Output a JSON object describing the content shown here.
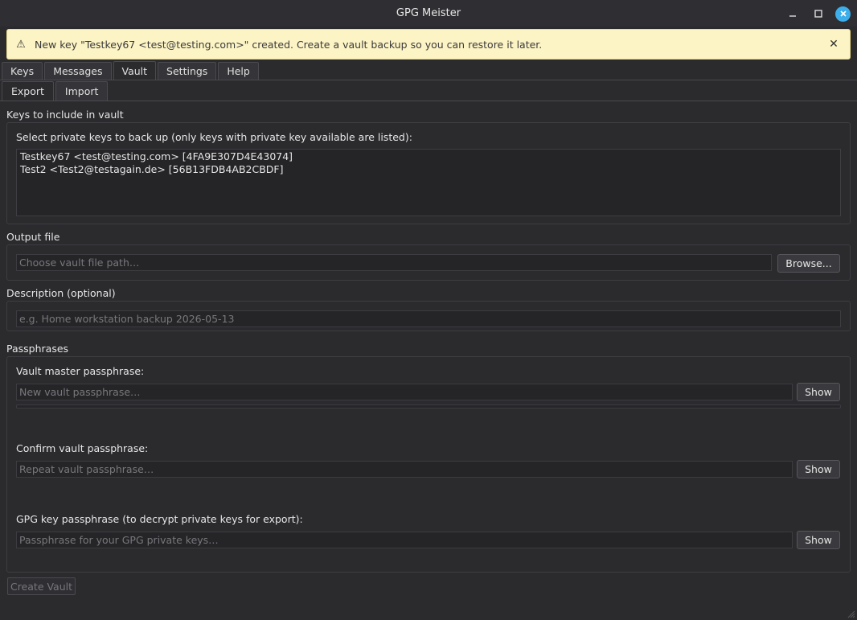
{
  "window": {
    "title": "GPG Meister"
  },
  "banner": {
    "message": "New key \"Testkey67 <test@testing.com>\" created. Create a vault backup so you can restore it later.",
    "close": "✕"
  },
  "tabs": [
    {
      "label": "Keys"
    },
    {
      "label": "Messages"
    },
    {
      "label": "Vault",
      "active": true
    },
    {
      "label": "Settings"
    },
    {
      "label": "Help"
    }
  ],
  "subtabs": [
    {
      "label": "Export",
      "active": true
    },
    {
      "label": "Import"
    }
  ],
  "keys_section": {
    "title": "Keys to include in vault",
    "instruction": "Select private keys to back up (only keys with private key available are listed):",
    "keys": [
      "Testkey67 <test@testing.com>  [4FA9E307D4E43074]",
      "Test2 <Test2@testagain.de>  [56B13FDB4AB2CBDF]"
    ]
  },
  "output_section": {
    "title": "Output file",
    "placeholder": "Choose vault file path…",
    "browse_label": "Browse..."
  },
  "description_section": {
    "title": "Description (optional)",
    "placeholder": "e.g. Home workstation backup 2026-05-13"
  },
  "passphrase_section": {
    "title": "Passphrases",
    "master_label": "Vault master passphrase:",
    "master_placeholder": "New vault passphrase…",
    "confirm_label": "Confirm vault passphrase:",
    "confirm_placeholder": "Repeat vault passphrase…",
    "gpg_label": "GPG key passphrase (to decrypt private keys for export):",
    "gpg_placeholder": "Passphrase for your GPG private keys…",
    "show_label": "Show",
    "strength_value": 0
  },
  "create_button": {
    "label": "Create Vault",
    "enabled": false
  },
  "colors": {
    "background": "#2b2b2e",
    "banner": "#fdf4c5",
    "accent": "#3daee9"
  }
}
